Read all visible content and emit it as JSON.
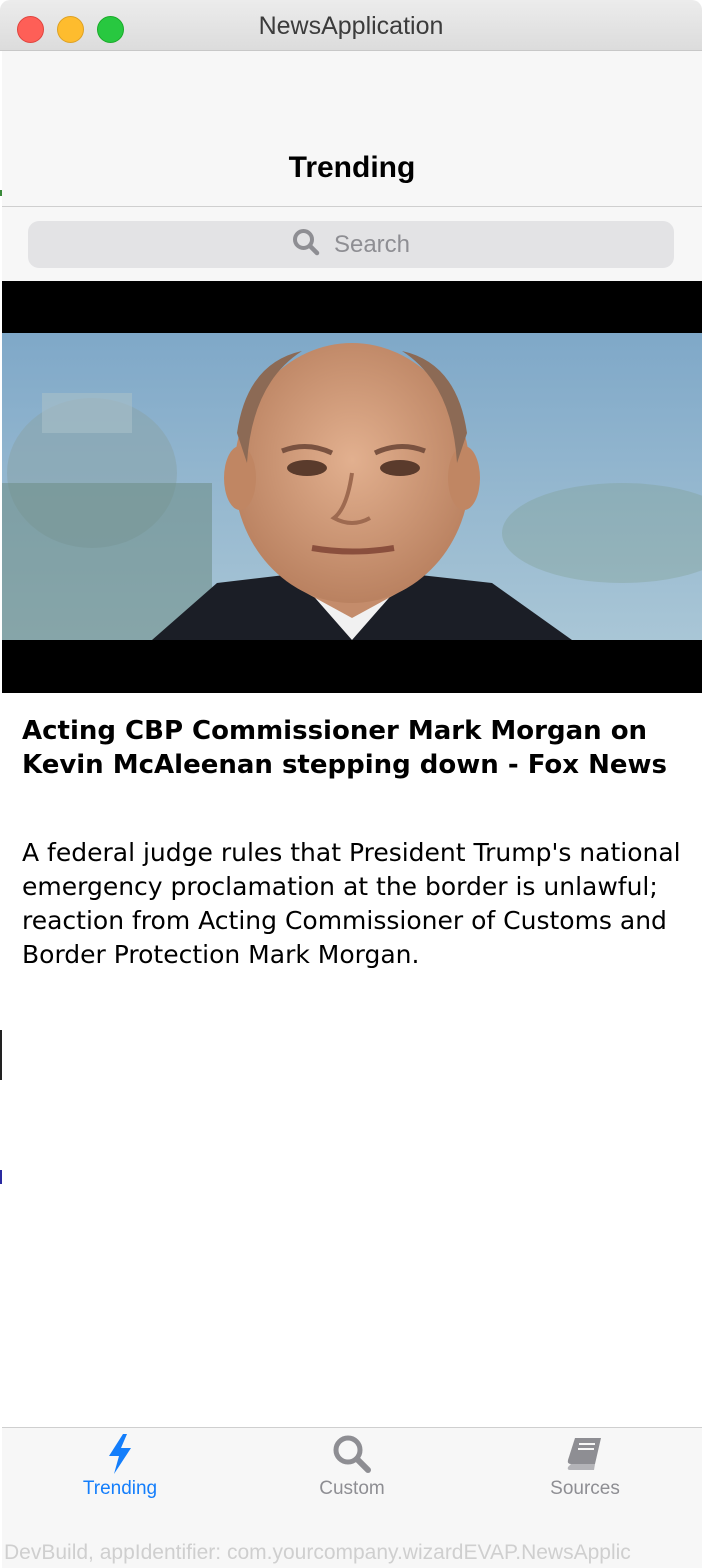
{
  "window": {
    "title": "NewsApplication"
  },
  "navbar": {
    "title": "Trending"
  },
  "search": {
    "placeholder": "Search",
    "icon": "search-icon"
  },
  "article": {
    "title": "Acting CBP Commissioner Mark Morgan on Kevin McAleenan stepping down - Fox News",
    "description": "A federal judge rules that President Trump's national emergency proclamation at the border is unlawful; reaction from Acting Commissioner of Customs and Border Protection Mark Morgan."
  },
  "tabs": [
    {
      "label": "Trending",
      "icon": "bolt-icon",
      "selected": true
    },
    {
      "label": "Custom",
      "icon": "search-icon",
      "selected": false
    },
    {
      "label": "Sources",
      "icon": "book-icon",
      "selected": false
    }
  ],
  "footer": {
    "build_info": "DevBuild, appIdentifier: com.yourcompany.wizardEVAP.NewsApplic"
  },
  "colors": {
    "accent": "#147efb",
    "inactive": "#8e8e93",
    "background": "#f7f7f7"
  }
}
